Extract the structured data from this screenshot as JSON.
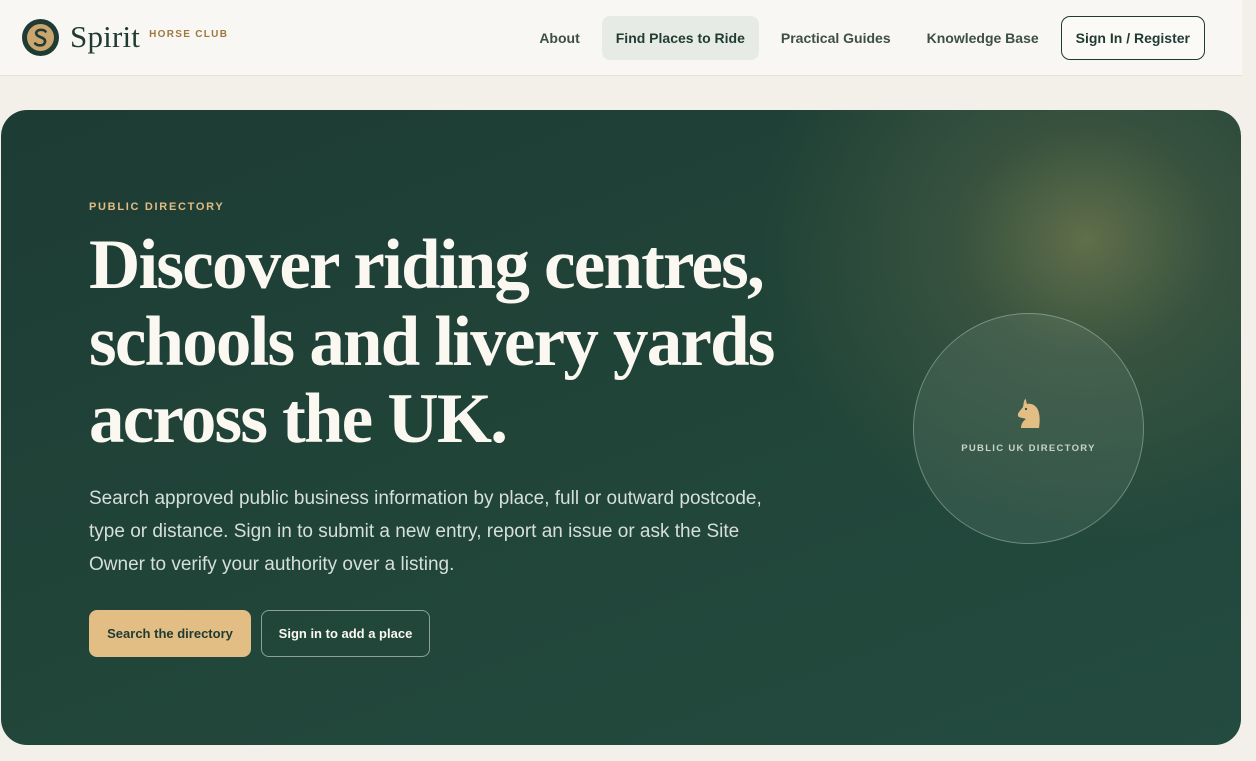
{
  "brand": {
    "name": "Spirit",
    "subtitle": "HORSE CLUB",
    "icon": "s-monogram-icon"
  },
  "nav": {
    "items": [
      {
        "label": "About",
        "active": false
      },
      {
        "label": "Find Places to Ride",
        "active": true
      },
      {
        "label": "Practical Guides",
        "active": false
      },
      {
        "label": "Knowledge Base",
        "active": false
      }
    ],
    "signin_label": "Sign In / Register"
  },
  "hero": {
    "eyebrow": "PUBLIC DIRECTORY",
    "headline": "Discover riding centres, schools and livery yards across the UK.",
    "lead": "Search approved public business information by place, full or outward postcode, type or distance. Sign in to submit a new entry, report an issue or ask the Site Owner to verify your authority over a listing.",
    "primary_cta": "Search the directory",
    "secondary_cta": "Sign in to add a place",
    "badge": {
      "icon": "horse-knight-icon",
      "label": "PUBLIC UK DIRECTORY"
    }
  },
  "colors": {
    "forest": "#1f3b33",
    "gold": "#e2bd84",
    "cream": "#f8f7f3",
    "accent_brown": "#a0783f"
  }
}
